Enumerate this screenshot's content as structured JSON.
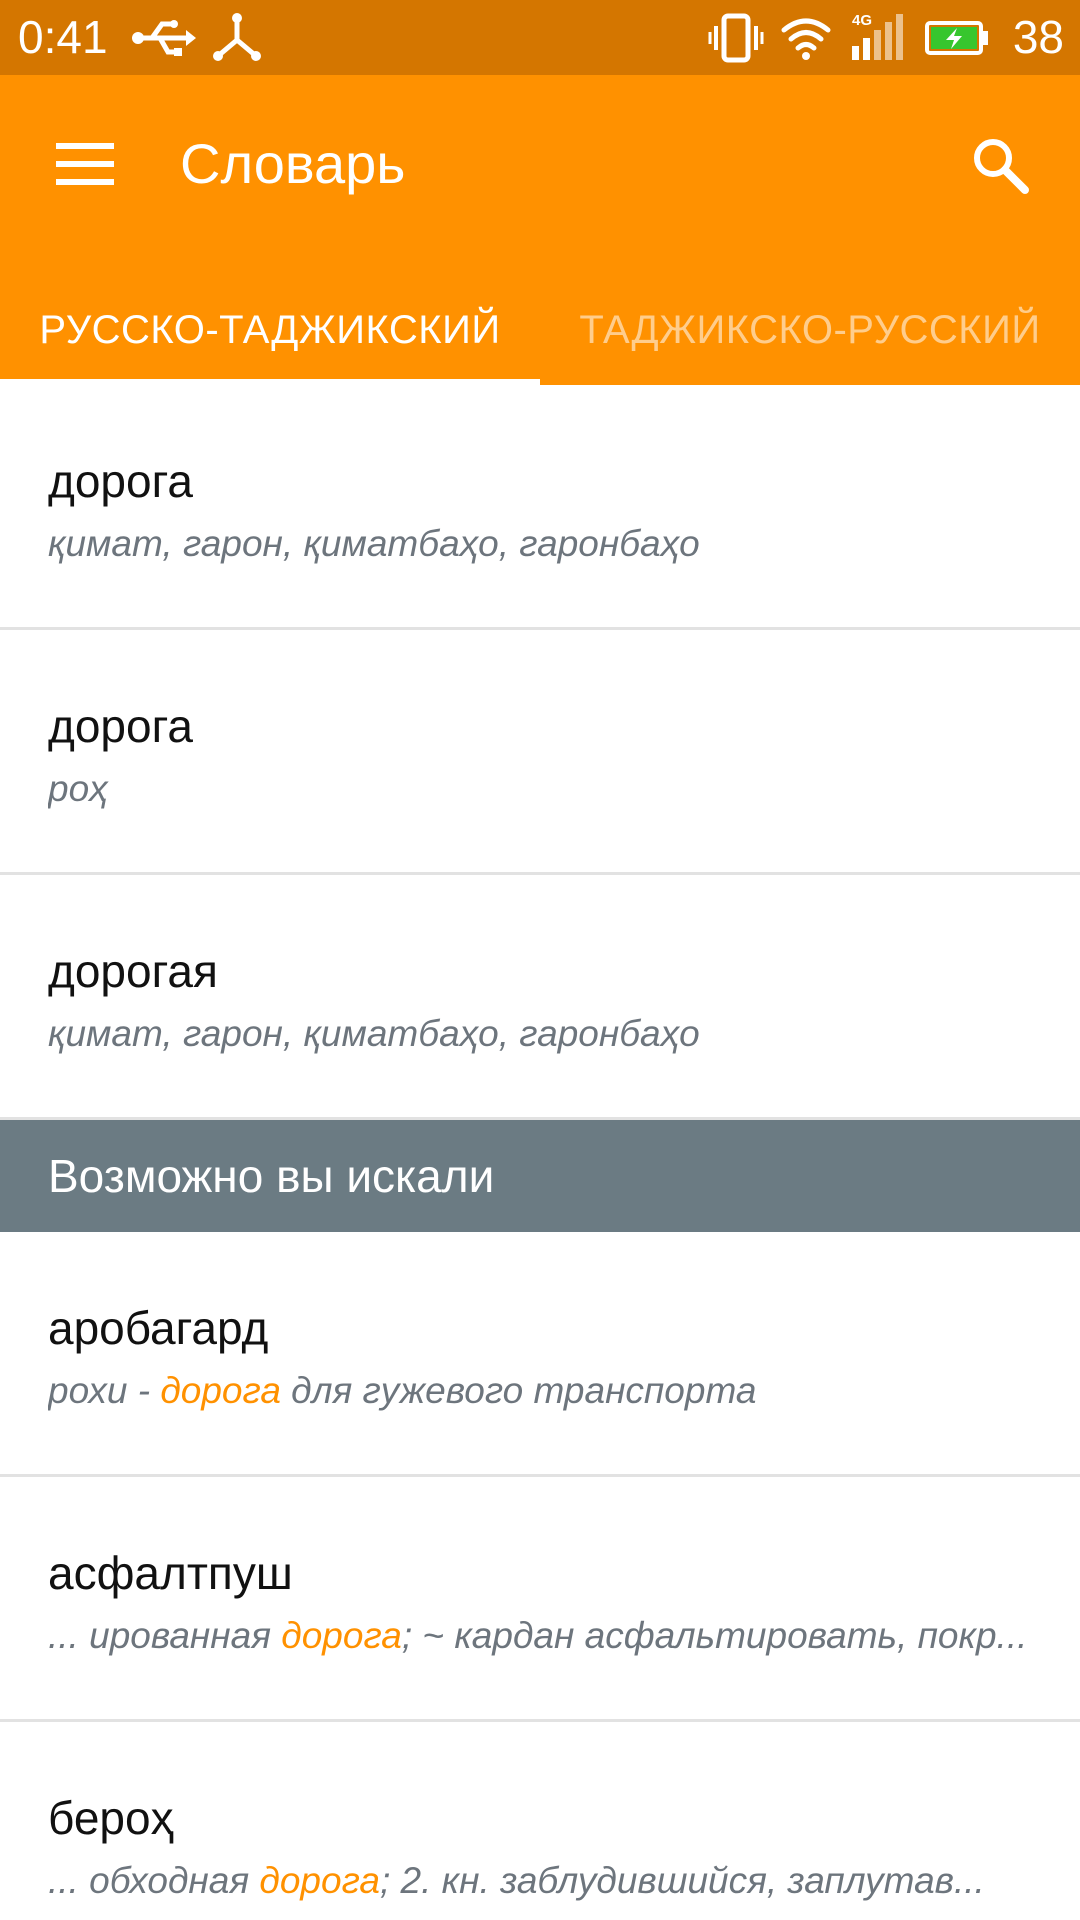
{
  "status_bar": {
    "time": "0:41",
    "network_type": "4G",
    "battery_level": "38",
    "icons": [
      "usb-icon",
      "share-icon",
      "vibrate-icon",
      "wifi-icon",
      "signal-icon",
      "battery-charging-icon"
    ]
  },
  "app_bar": {
    "title": "Словарь",
    "menu_icon": "hamburger-menu-icon",
    "search_icon": "search-icon"
  },
  "tabs": [
    {
      "label": "РУССКО-ТАДЖИКСКИЙ",
      "active": true
    },
    {
      "label": "ТАДЖИКСКО-РУССКИЙ",
      "active": false
    }
  ],
  "entries": [
    {
      "word": "дорога",
      "translation": "қимат, гарон, қиматбаҳо, гаронбаҳо"
    },
    {
      "word": "дорога",
      "translation": "роҳ"
    },
    {
      "word": "дорогая",
      "translation": "қимат, гарон, қиматбаҳо, гаронбаҳо"
    }
  ],
  "suggestions_header": "Возможно вы искали",
  "suggestions": [
    {
      "word": "аробагард",
      "before": " рохи - ",
      "highlight": "дорога",
      "after": " для гужевого транспорта"
    },
    {
      "word": "асфалтпуш",
      "before": "... ированная ",
      "highlight": "дорога",
      "after": "; ~ кардан асфальтировать, покр..."
    },
    {
      "word": "бероҳ",
      "before": "...  обходная ",
      "highlight": "дорога",
      "after": "; 2. кн. заблудившийся, заплутав..."
    }
  ],
  "colors": {
    "status_bar": "#D47600",
    "app_bar": "#FF9100",
    "section_header": "#6B7B83",
    "highlight": "#FF9100"
  }
}
